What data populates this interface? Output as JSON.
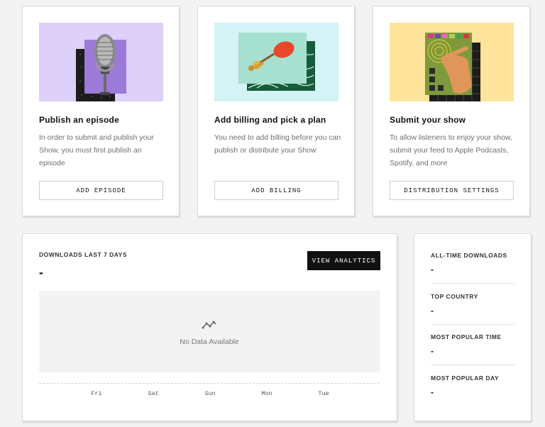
{
  "steps": [
    {
      "title": "Publish an episode",
      "description": "In order to submit and publish your Show, you must first publish an episode",
      "button": "ADD EPISODE",
      "illustration": "microphone-illustration",
      "bg_color": "#ddd0f9"
    },
    {
      "title": "Add billing and pick a plan",
      "description": "You need to add billing before you can publish or distribute your Show",
      "button": "ADD BILLING",
      "illustration": "billing-illustration",
      "bg_color": "#d3f3f6"
    },
    {
      "title": "Submit your show",
      "description": "To allow listeners to enjoy your show, submit your feed to Apple Podcasts, Spotify, and more",
      "button": "DISTRIBUTION SETTINGS",
      "illustration": "distribution-illustration",
      "bg_color": "#fde49a"
    }
  ],
  "downloads": {
    "label": "DOWNLOADS LAST 7 DAYS",
    "value": "-",
    "analytics_button": "VIEW ANALYTICS",
    "empty_icon": "line-chart-icon",
    "empty_text": "No Data Available",
    "x_ticks": [
      "Fri",
      "Sat",
      "Sun",
      "Mon",
      "Tue"
    ]
  },
  "stats": [
    {
      "label": "ALL-TIME DOWNLOADS",
      "value": "-"
    },
    {
      "label": "TOP COUNTRY",
      "value": "-"
    },
    {
      "label": "MOST POPULAR TIME",
      "value": "-"
    },
    {
      "label": "MOST POPULAR DAY",
      "value": "-"
    }
  ]
}
